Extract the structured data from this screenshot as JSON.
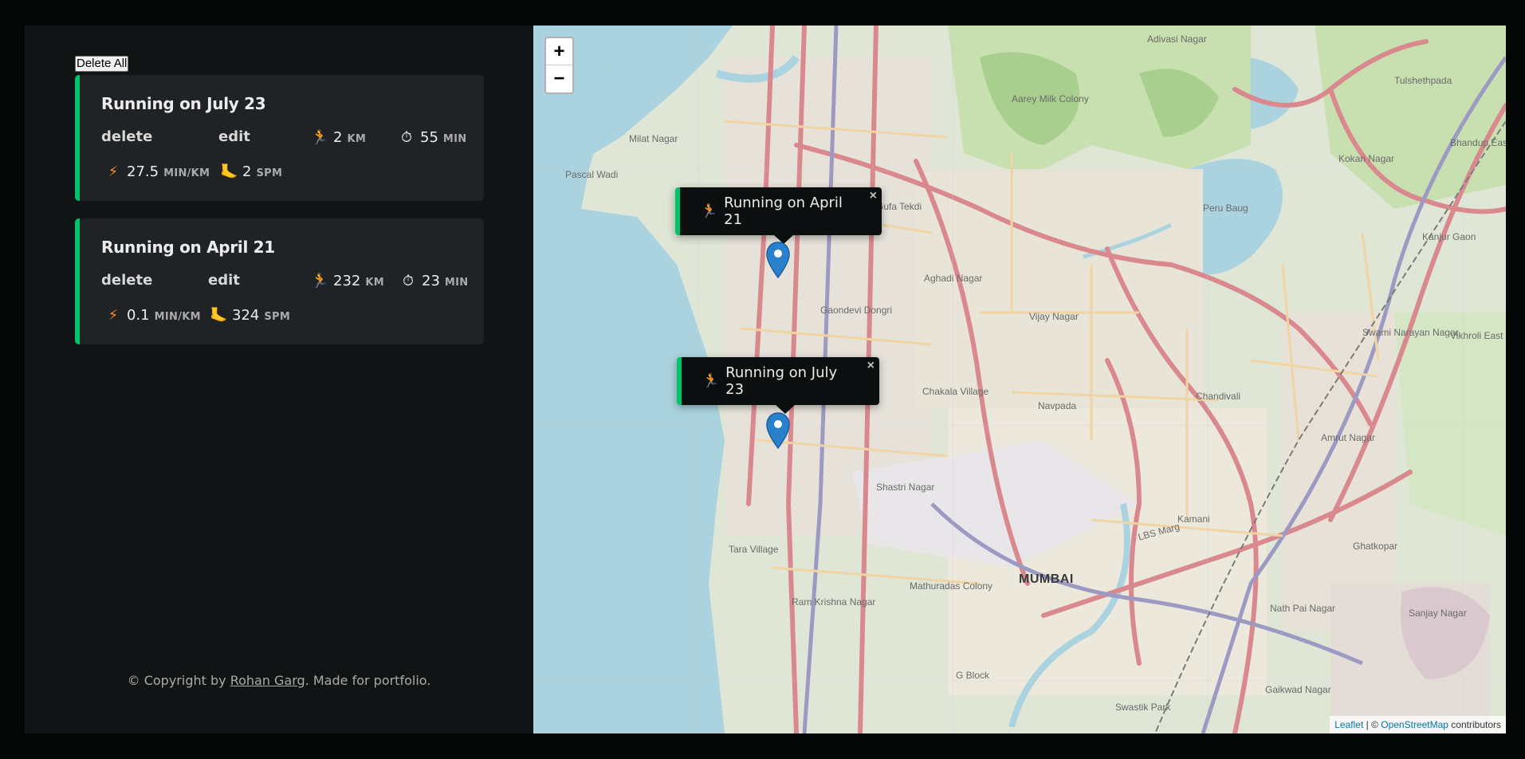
{
  "sidebar": {
    "delete_all_label": "Delete All",
    "workouts": [
      {
        "title": "Running on July 23",
        "delete_label": "delete",
        "edit_label": "edit",
        "distance": "2",
        "distance_unit": "KM",
        "duration": "55",
        "duration_unit": "MIN",
        "pace": "27.5",
        "pace_unit": "MIN/KM",
        "cadence": "2",
        "cadence_unit": "SPM"
      },
      {
        "title": "Running on April 21",
        "delete_label": "delete",
        "edit_label": "edit",
        "distance": "232",
        "distance_unit": "KM",
        "duration": "23",
        "duration_unit": "MIN",
        "pace": "0.1",
        "pace_unit": "MIN/KM",
        "cadence": "324",
        "cadence_unit": "SPM"
      }
    ],
    "icons": {
      "distance": "🏃",
      "duration": "⏱",
      "pace": "⚡",
      "cadence": "🦶"
    },
    "footer": {
      "prefix": "© Copyright by ",
      "author": "Rohan Garg",
      "suffix": ". Made for portfolio."
    }
  },
  "map": {
    "zoom_in_label": "+",
    "zoom_out_label": "−",
    "popups": [
      {
        "text": "Running on April 21",
        "icon": "🏃",
        "close": "×"
      },
      {
        "text": "Running on July 23",
        "icon": "🏃",
        "close": "×"
      }
    ],
    "labels": {
      "mumbai": "MUMBAI",
      "aarey": "Aarey Milk Colony",
      "milat": "Milat Nagar",
      "gaondevi": "Gaondevi Dongri",
      "aghadi": "Aghadi Nagar",
      "vijay": "Vijay Nagar",
      "chakala": "Chakala Village",
      "navpada": "Navpada",
      "chandivali": "Chandivali",
      "shastri": "Shastri Nagar",
      "kamani": "Kamani",
      "mathuradas": "Mathuradas Colony",
      "ramkrishna": "Ram Krishna Nagar",
      "tara": "Tara Village",
      "gblock": "G Block",
      "ghatkopar": "Ghatkopar",
      "swami": "Swami Narayan Nagar",
      "amrut": "Amrut Nagar",
      "nathpai": "Nath Pai Nagar",
      "sanjay": "Sanjay Nagar",
      "perubaug": "Peru Baug",
      "kokan": "Kokan Nagar",
      "kanjur": "Kanjur Gaon",
      "vikhroli": "Vikhroli East",
      "bhandup": "Bhandup East",
      "tulshet": "Tulshethpada",
      "adivasi": "Adivasi Nagar",
      "pascal": "Pascal Wadi",
      "lbs": "LBS Marg",
      "gaikwad": "Gaikwad Nagar",
      "swastik": "Swastik Park",
      "gufa": "Gufa Tekdi"
    },
    "attribution": {
      "leaflet": "Leaflet",
      "sep": " | © ",
      "osm": "OpenStreetMap",
      "suffix": " contributors"
    }
  },
  "colors": {
    "accent_running": "#00c46a",
    "sidebar_bg": "#111415",
    "card_bg": "#202326"
  }
}
